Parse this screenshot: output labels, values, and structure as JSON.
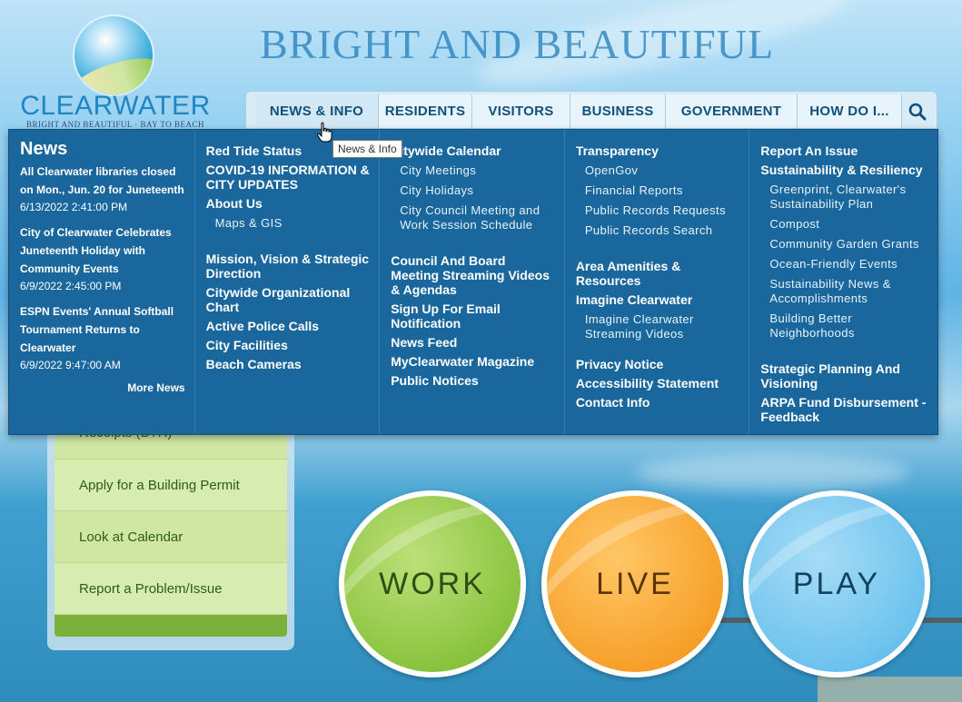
{
  "header": {
    "logo_word": "CLEARWATER",
    "logo_tagline": "BRIGHT AND BEAUTIFUL · BAY TO BEACH",
    "headline": "BRIGHT AND BEAUTIFUL"
  },
  "nav": {
    "items": [
      {
        "label": "NEWS & INFO"
      },
      {
        "label": "RESIDENTS"
      },
      {
        "label": "VISITORS"
      },
      {
        "label": "BUSINESS"
      },
      {
        "label": "GOVERNMENT"
      },
      {
        "label": "HOW DO I..."
      }
    ],
    "search_icon": "search-icon"
  },
  "tooltip": "News & Info",
  "menu": {
    "news": {
      "title": "News",
      "items": [
        {
          "headline": "All Clearwater libraries closed on Mon., Jun. 20 for Juneteenth",
          "date": "6/13/2022 2:41:00 PM"
        },
        {
          "headline": "City of Clearwater Celebrates Juneteenth Holiday with Community Events",
          "date": "6/9/2022 2:45:00 PM"
        },
        {
          "headline": "ESPN Events' Annual Softball Tournament Returns to Clearwater",
          "date": "6/9/2022 9:47:00 AM"
        }
      ],
      "more": "More News"
    },
    "col2": {
      "red_tide": "Red Tide Status",
      "covid": "COVID-19 INFORMATION & CITY UPDATES",
      "about": "About Us",
      "maps": "Maps & GIS",
      "mission": "Mission, Vision & Strategic Direction",
      "org_chart": "Citywide Organizational Chart",
      "police": "Active Police Calls",
      "facilities": "City Facilities",
      "cameras": "Beach Cameras"
    },
    "col3": {
      "calendar": "Citywide Calendar",
      "meetings": "City Meetings",
      "holidays": "City Holidays",
      "council": "City Council Meeting and Work Session Schedule",
      "streaming": "Council And Board Meeting Streaming Videos & Agendas",
      "signup": "Sign Up For Email Notification",
      "feed": "News Feed",
      "magazine": "MyClearwater Magazine",
      "notices": "Public Notices"
    },
    "col4": {
      "transparency": "Transparency",
      "opengov": "OpenGov",
      "financial": "Financial Reports",
      "requests": "Public Records Requests",
      "search": "Public Records Search",
      "amenities": "Area Amenities & Resources",
      "imagine": "Imagine Clearwater",
      "imagine_video": "Imagine Clearwater Streaming Videos",
      "privacy": "Privacy Notice",
      "accessibility": "Accessibility Statement",
      "contact": "Contact Info"
    },
    "col5": {
      "report": "Report An Issue",
      "sustain": "Sustainability & Resiliency",
      "greenprint": "Greenprint, Clearwater's Sustainability Plan",
      "compost": "Compost",
      "garden": "Community Garden Grants",
      "ocean": "Ocean-Friendly Events",
      "sustain_news": "Sustainability News & Accomplishments",
      "better": "Building Better Neighborhoods",
      "strategic": "Strategic Planning And Visioning",
      "arpa": "ARPA Fund Disbursement - Feedback"
    }
  },
  "quick_links": [
    {
      "label": "Receipts (BTR)"
    },
    {
      "label": "Apply for a Building Permit"
    },
    {
      "label": "Look at Calendar"
    },
    {
      "label": "Report a Problem/Issue"
    }
  ],
  "circles": {
    "work": "WORK",
    "live": "LIVE",
    "play": "PLAY"
  },
  "colors": {
    "menu_bg": "#19679d",
    "nav_text": "#12507a",
    "work": "#8bc43f",
    "live": "#f7a12b",
    "play": "#6ec3ee"
  }
}
